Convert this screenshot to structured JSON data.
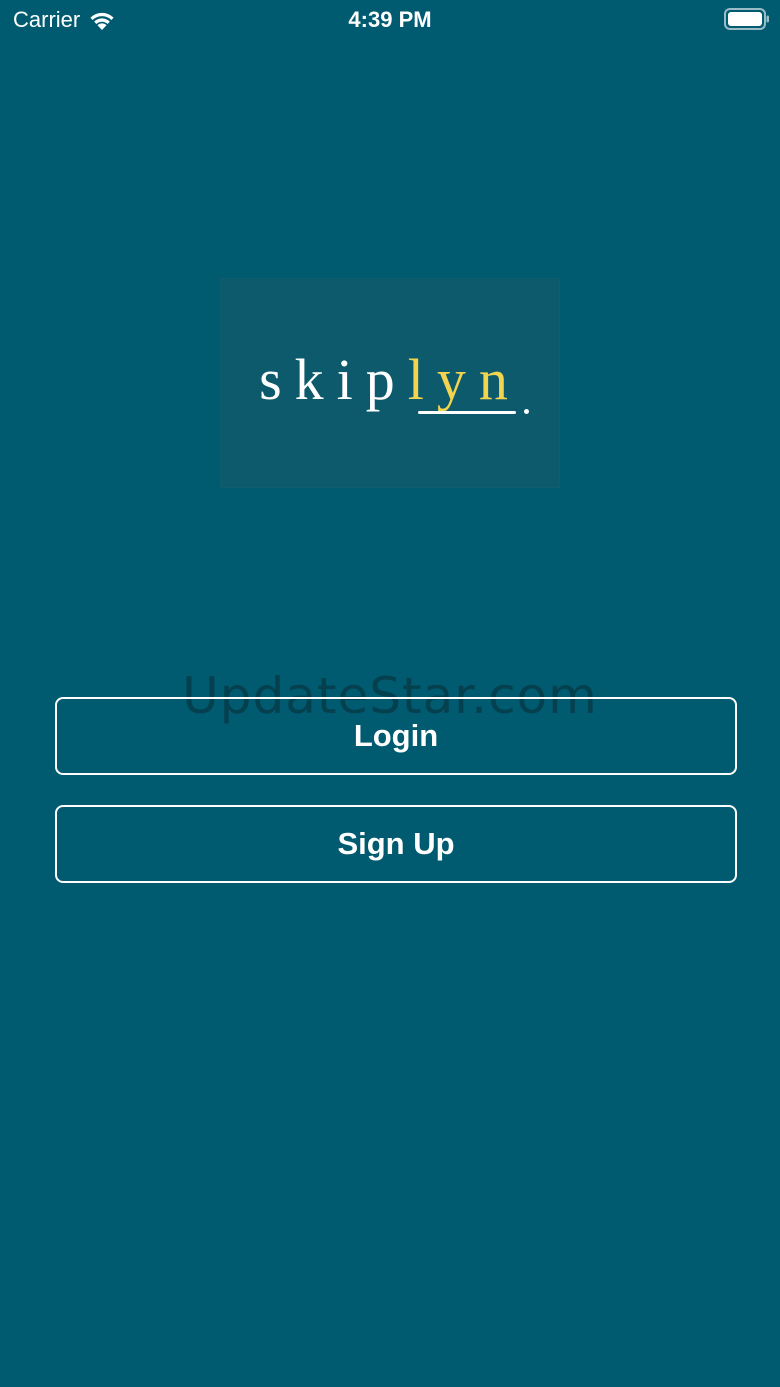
{
  "status_bar": {
    "carrier": "Carrier",
    "time": "4:39 PM",
    "wifi_icon": "wifi-icon",
    "battery_icon": "battery-icon"
  },
  "logo": {
    "part1": "skip",
    "part2": "lyn",
    "accent_color": "#f2d44e"
  },
  "watermark": {
    "text": "UpdateStar.com"
  },
  "buttons": {
    "login_label": "Login",
    "signup_label": "Sign Up"
  },
  "colors": {
    "background": "#015b70",
    "button_border": "#ffffff"
  }
}
